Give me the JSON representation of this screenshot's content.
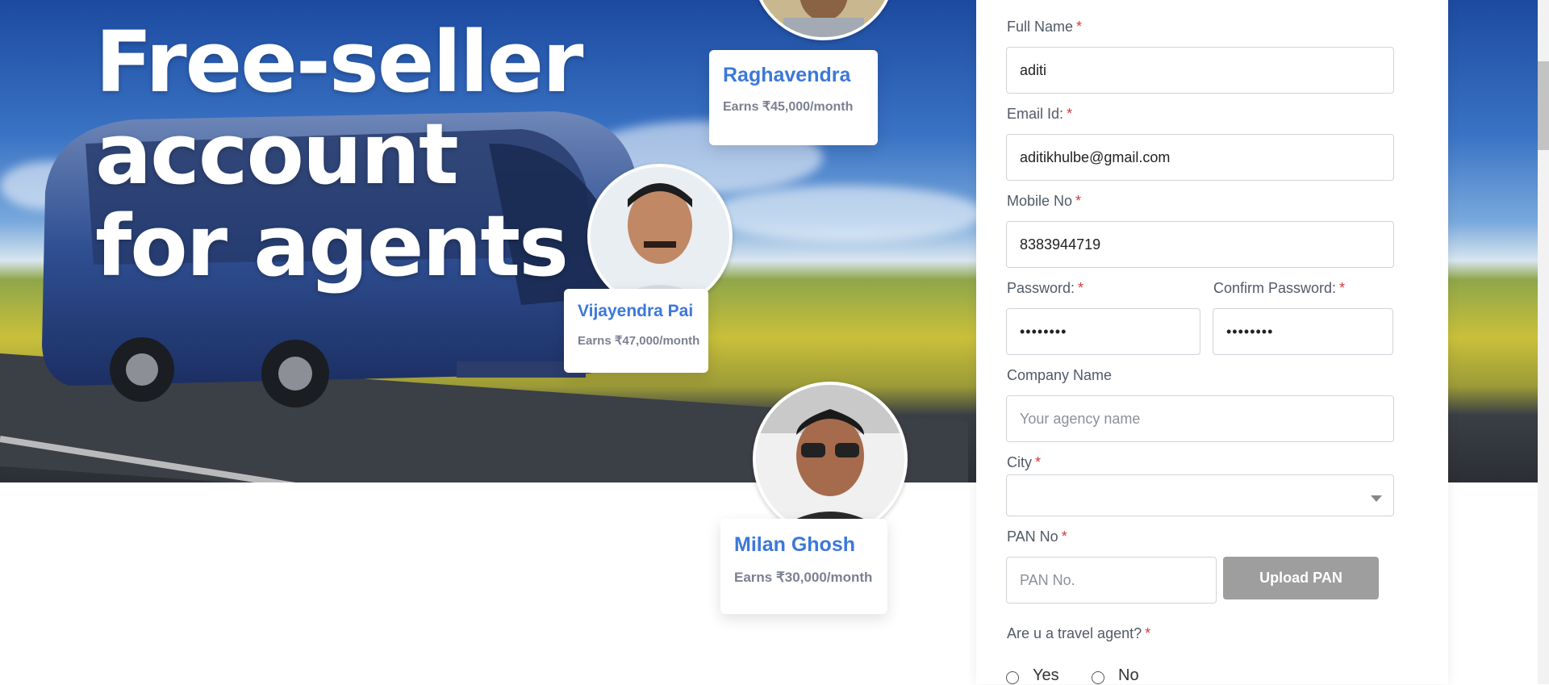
{
  "hero": {
    "title": "Free-seller account for agents"
  },
  "agents": [
    {
      "name": "Raghavendra",
      "earnings": "Earns ₹45,000/month"
    },
    {
      "name": "Vijayendra Pai",
      "earnings": "Earns ₹47,000/month"
    },
    {
      "name": "Milan Ghosh",
      "earnings": "Earns ₹30,000/month"
    }
  ],
  "form": {
    "full_name": {
      "label": "Full Name",
      "value": "aditi"
    },
    "email": {
      "label": "Email Id:",
      "value": "aditikhulbe@gmail.com"
    },
    "mobile": {
      "label": "Mobile No",
      "value": "8383944719"
    },
    "password": {
      "label": "Password:",
      "value": "••••••••"
    },
    "confirm_password": {
      "label": "Confirm Password:",
      "value": "••••••••"
    },
    "company": {
      "label": "Company Name",
      "placeholder": "Your agency name"
    },
    "city": {
      "label": "City",
      "value": ""
    },
    "pan": {
      "label": "PAN No",
      "placeholder": "PAN No.",
      "upload_label": "Upload PAN"
    },
    "travel_agent": {
      "question": "Are u a travel agent?",
      "options": [
        "Yes",
        "No"
      ]
    },
    "required_marker": "*"
  },
  "icons": [
    "chevron-down-icon"
  ],
  "colors": {
    "accent": "#3c78d8",
    "required": "#d33a3a",
    "button_disabled": "#9e9e9e"
  }
}
